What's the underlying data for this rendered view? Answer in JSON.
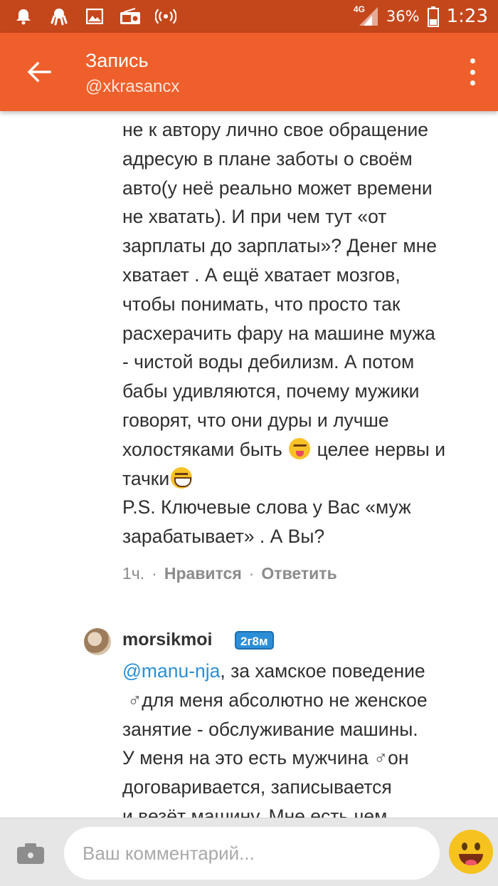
{
  "status_bar": {
    "network": "4G",
    "battery": "36%",
    "time": "1:23"
  },
  "app_bar": {
    "title": "Запись",
    "subtitle": "@xkrasancx"
  },
  "comment1": {
    "lines": [
      "не к автору лично свое обращение",
      "адресую в плане заботы о своём",
      "авто(у неё реально может времени",
      "не хватать). И при чем тут «от",
      "зарплаты до зарплаты»? Денег мне",
      "хватает . А ещё хватает мозгов,",
      "чтобы понимать, что просто так",
      "расхерачить фару на машине мужа",
      "- чистой воды дебилизм. А потом",
      "бабы удивляются, почему мужики",
      "говорят, что они дуры и лучше"
    ],
    "line12_a": "холостяками быть",
    "line12_b": "целее нервы и",
    "line13": "тачки",
    "ps_line1": "P.S.  Ключевые слова у Вас «муж",
    "ps_line2": "зарабатывает» . А Вы?",
    "time": "1ч.",
    "sep": "·",
    "like": "Нравится",
    "reply": "Ответить"
  },
  "comment2": {
    "username": "morsikmoi",
    "badge": "2г8м",
    "mention": "@manu-nja",
    "line1_rest": ", за хамское поведение",
    "male_sign": "♂",
    "line2": "для меня абсолютно не женское",
    "line3": "занятие - обслуживание машины.",
    "line4_a": "У меня на это есть мужчина ",
    "line4_b": "он",
    "line5": "договаривается, записывается",
    "line6": "и везёт машину. Мне есть чем"
  },
  "input_bar": {
    "placeholder": "Ваш комментарий..."
  }
}
